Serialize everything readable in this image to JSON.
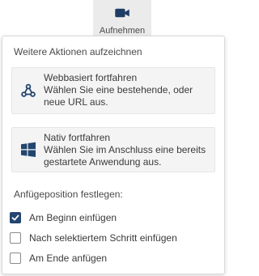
{
  "header": {
    "record_button": {
      "label": "Aufnehmen",
      "icon": "video-camera-icon"
    }
  },
  "panel": {
    "title": "Weitere Aktionen aufzeichnen",
    "options": [
      {
        "icon": "web-hook-icon",
        "title": "Webbasiert fortfahren",
        "line1": "Wählen Sie eine bestehende, oder",
        "line2": "neue URL aus."
      },
      {
        "icon": "windows-logo-icon",
        "title": "Nativ fortfahren",
        "line1": "Wählen Sie im Anschluss eine bereits",
        "line2": "gestartete Anwendung aus."
      }
    ],
    "position_title": "Anfügeposition festlegen:",
    "positions": [
      {
        "label": "Am Beginn einfügen",
        "checked": true
      },
      {
        "label": "Nach selektiertem Schritt einfügen",
        "checked": false
      },
      {
        "label": "Am Ende anfügen",
        "checked": false
      }
    ]
  },
  "colors": {
    "accent": "#23456f",
    "card_background": "#f4f4f4",
    "tab_background": "#ebebeb"
  }
}
